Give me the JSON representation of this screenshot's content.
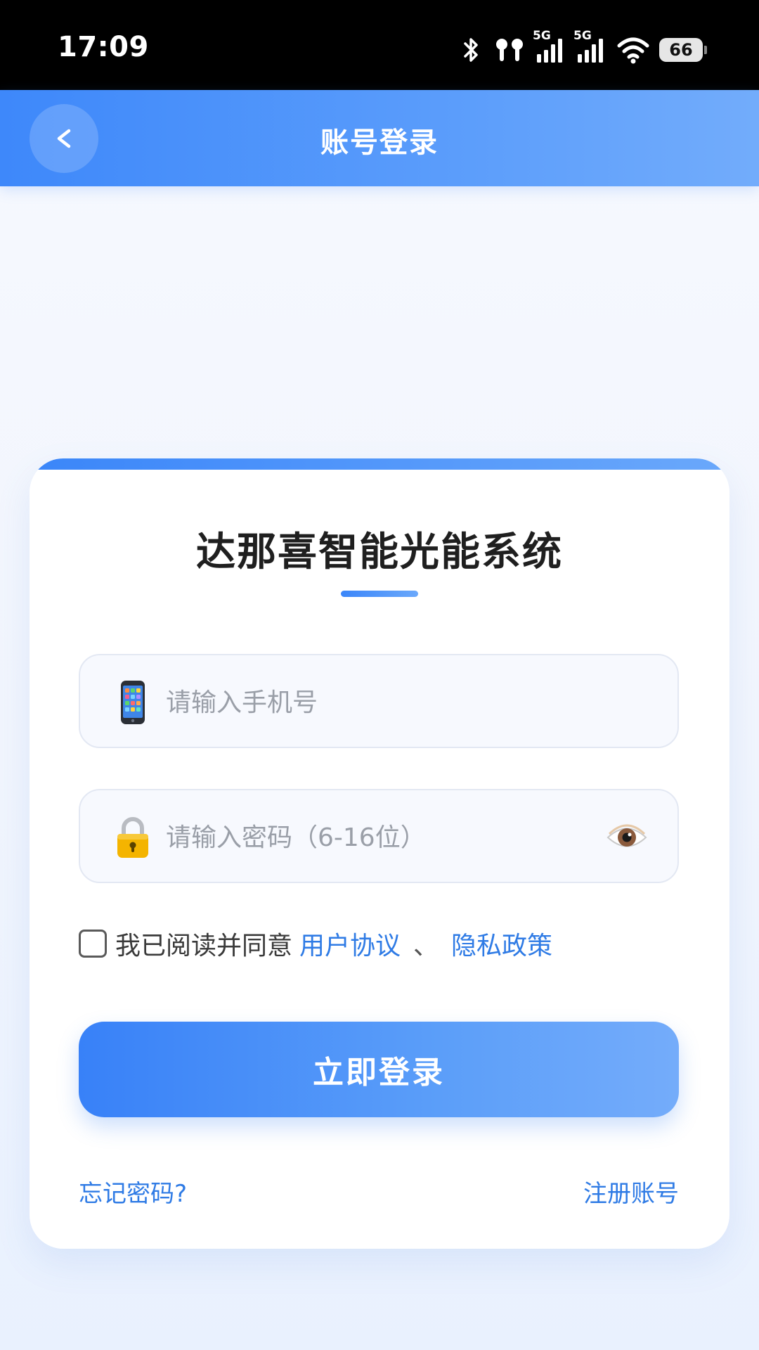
{
  "status_bar": {
    "time": "17:09",
    "network_1": "5G",
    "network_2": "5G",
    "battery": "66",
    "icons": [
      "bluetooth-icon",
      "earbuds-icon",
      "signal-icon",
      "signal-icon",
      "wifi-icon",
      "battery-icon"
    ]
  },
  "nav": {
    "back_icon": "chevron-left-icon",
    "title": "账号登录"
  },
  "card": {
    "title": "达那喜智能光能系统",
    "phone_input": {
      "value": "",
      "placeholder": "请输入手机号",
      "icon": "mobile-phone-icon"
    },
    "password_input": {
      "value": "",
      "placeholder": "请输入密码（6-16位）",
      "icon": "lock-icon",
      "toggle_icon": "eye-icon"
    },
    "agreement": {
      "checked": false,
      "text": "我已阅读并同意",
      "user_agreement": "用户协议",
      "separator": "、",
      "privacy_policy": "隐私政策"
    },
    "login_button": "立即登录",
    "forgot_password": "忘记密码?",
    "register": "注册账号"
  },
  "colors": {
    "primary": "#3e88fa",
    "link": "#2f7be5",
    "title_text": "#1f1f1f",
    "placeholder": "#9a9fa8"
  }
}
